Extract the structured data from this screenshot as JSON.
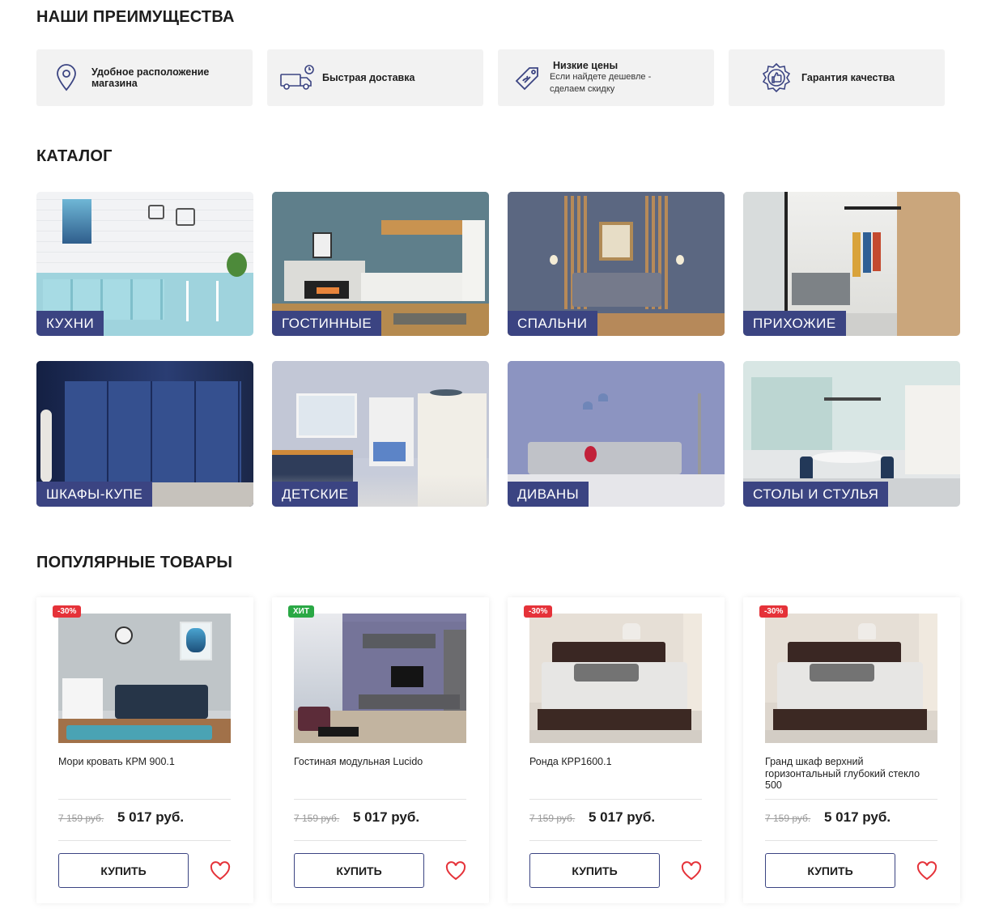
{
  "advantages": {
    "title": "НАШИ ПРЕИМУЩЕСТВА",
    "items": [
      {
        "icon": "location-pin-icon",
        "label": "Удобное расположение магазина",
        "sub": ""
      },
      {
        "icon": "delivery-truck-icon",
        "label": "Быстрая доставка",
        "sub": ""
      },
      {
        "icon": "price-tag-icon",
        "label": "Низкие цены",
        "sub": "Если найдете дешевле - сделаем скидку"
      },
      {
        "icon": "quality-badge-icon",
        "label": "Гарантия качества",
        "sub": ""
      }
    ]
  },
  "catalog": {
    "title": "КАТАЛОГ",
    "items": [
      {
        "label": "КУХНИ"
      },
      {
        "label": "ГОСТИННЫЕ"
      },
      {
        "label": "СПАЛЬНИ"
      },
      {
        "label": "ПРИХОЖИЕ"
      },
      {
        "label": "ШКАФЫ-КУПЕ"
      },
      {
        "label": "ДЕТСКИЕ"
      },
      {
        "label": "ДИВАНЫ"
      },
      {
        "label": "СТОЛЫ И СТУЛЬЯ"
      }
    ]
  },
  "popular": {
    "title": "ПОПУЛЯРНЫЕ ТОВАРЫ",
    "products": [
      {
        "badge": "-30%",
        "badge_type": "sale",
        "name": "Мори кровать КРМ 900.1",
        "old_price": "7 159 руб.",
        "price": "5 017 руб.",
        "buy_label": "КУПИТЬ"
      },
      {
        "badge": "ХИТ",
        "badge_type": "hit",
        "name": "Гостиная модульная Lucido",
        "old_price": "7 159 руб.",
        "price": "5 017 руб.",
        "buy_label": "КУПИТЬ"
      },
      {
        "badge": "-30%",
        "badge_type": "sale",
        "name": "Ронда КРР1600.1",
        "old_price": "7 159 руб.",
        "price": "5 017 руб.",
        "buy_label": "КУПИТЬ"
      },
      {
        "badge": "-30%",
        "badge_type": "sale",
        "name": "Гранд шкаф верхний горизонтальный глубокий стекло 500",
        "old_price": "7 159 руб.",
        "price": "5 017 руб.",
        "buy_label": "КУПИТЬ"
      }
    ]
  },
  "colors": {
    "accent": "#3b4482",
    "sale": "#e53239",
    "hit": "#2aa845",
    "heart": "#e53239",
    "card_bg": "#f2f2f2"
  }
}
